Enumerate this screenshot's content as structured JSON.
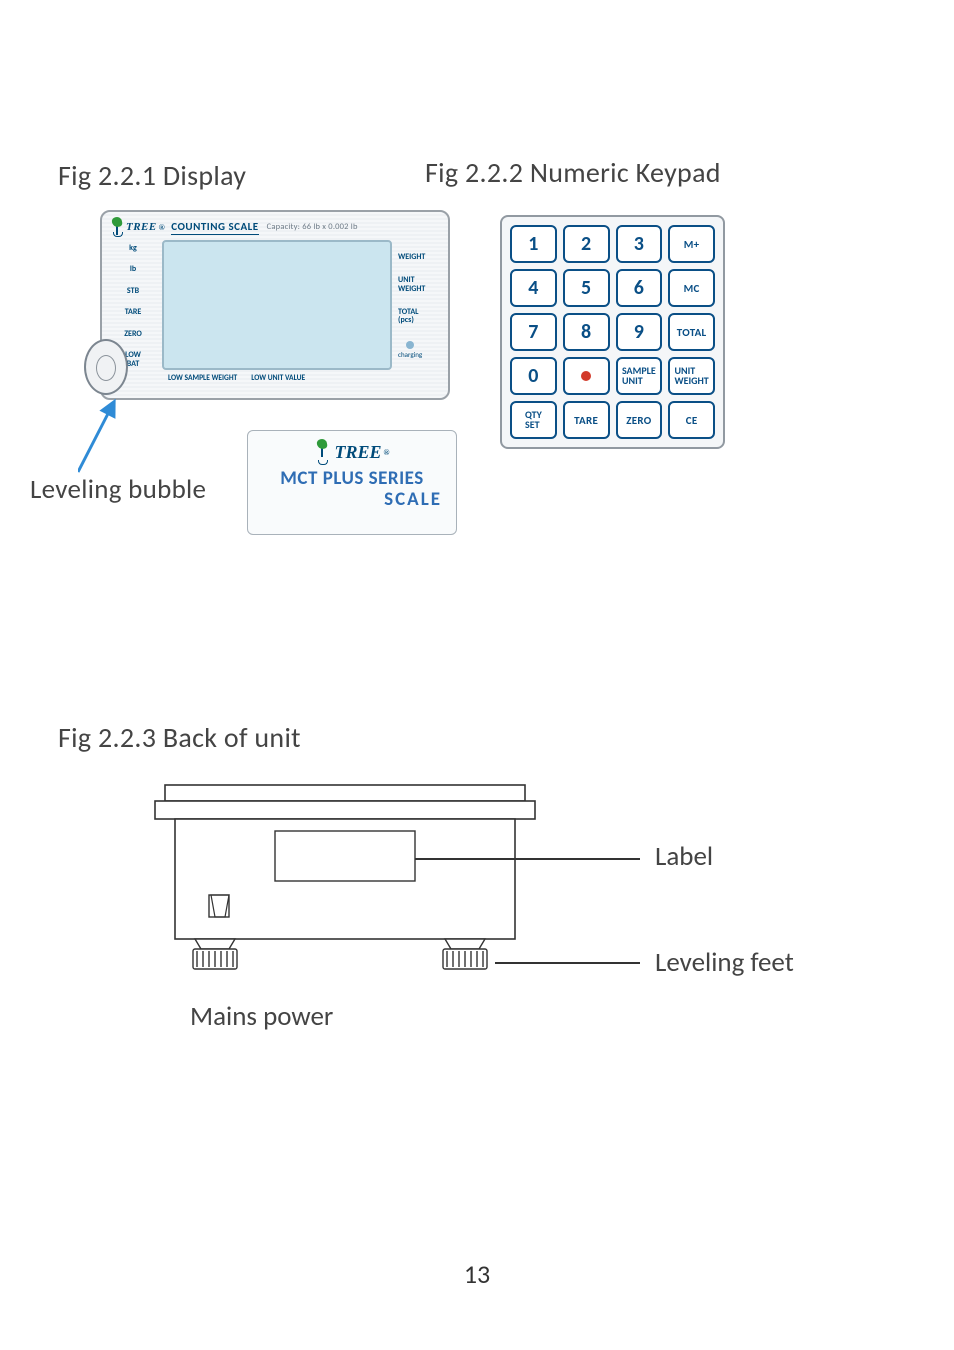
{
  "fig221": {
    "caption": "Fig 2.2.1   Display",
    "brand": "TREE",
    "brand_reg": "®",
    "header_title": "COUNTING SCALE",
    "header_capacity": "Capacity: 66 lb x 0.002 lb",
    "left_indicators": [
      "kg",
      "lb",
      "STB",
      "TARE",
      "ZERO",
      "LOW\nBAT"
    ],
    "right_indicators": [
      {
        "label": "WEIGHT"
      },
      {
        "label": "UNIT\nWEIGHT"
      },
      {
        "label": "TOTAL\n(pcs)"
      }
    ],
    "charging_label": "charging",
    "footer": [
      "LOW SAMPLE WEIGHT",
      "LOW UNIT VALUE"
    ],
    "leveling_caption": "Leveling bubble",
    "badge_line1": "MCT PLUS SERIES",
    "badge_line2": "SCALE"
  },
  "fig222": {
    "caption": "Fig 2.2.2    Numeric Keypad",
    "keys": [
      {
        "label": "1",
        "size": "num"
      },
      {
        "label": "2",
        "size": "num"
      },
      {
        "label": "3",
        "size": "num"
      },
      {
        "label": "M+",
        "size": "small"
      },
      {
        "label": "4",
        "size": "num"
      },
      {
        "label": "5",
        "size": "num"
      },
      {
        "label": "6",
        "size": "num"
      },
      {
        "label": "MC",
        "size": "small"
      },
      {
        "label": "7",
        "size": "num"
      },
      {
        "label": "8",
        "size": "num"
      },
      {
        "label": "9",
        "size": "num"
      },
      {
        "label": "TOTAL",
        "size": "small"
      },
      {
        "label": "0",
        "size": "num"
      },
      {
        "label": "●",
        "size": "dot"
      },
      {
        "label": "SAMPLE\nUNIT",
        "size": "stack"
      },
      {
        "label": "UNIT\nWEIGHT",
        "size": "stack"
      },
      {
        "label": "QTY\nSET",
        "size": "stack"
      },
      {
        "label": "TARE",
        "size": "small"
      },
      {
        "label": "ZERO",
        "size": "small"
      },
      {
        "label": "CE",
        "size": "small"
      }
    ]
  },
  "fig223": {
    "caption": "Fig 2.2.3    Back of unit",
    "callout_label": "Label",
    "callout_feet": "Leveling feet",
    "callout_power": "Mains power"
  },
  "page_number": "13"
}
